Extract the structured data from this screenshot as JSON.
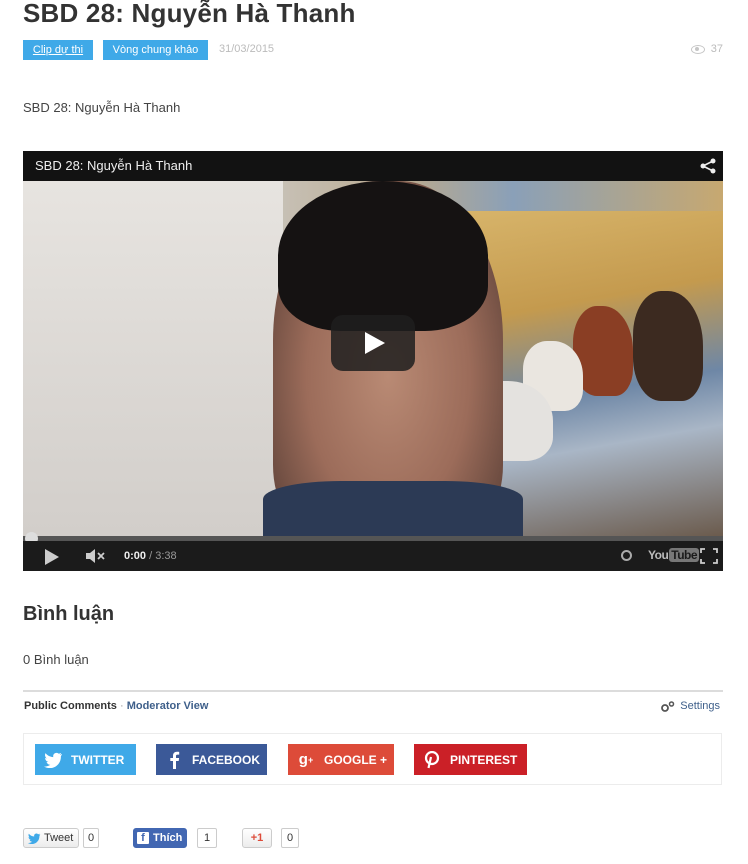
{
  "post": {
    "title": "SBD 28: Nguyễn Hà Thanh",
    "tags": [
      "Clip dự thi",
      "Vòng chung khảo"
    ],
    "date": "31/03/2015",
    "views": "37",
    "intro": "SBD 28: Nguyễn Hà Thanh"
  },
  "video": {
    "title": "SBD 28: Nguyễn Hà Thanh",
    "current_time": "0:00",
    "duration": "/ 3:38",
    "logo_you": "You",
    "logo_tube": "Tube",
    "progress": 0
  },
  "comments": {
    "heading": "Bình luận",
    "count_text": "0 Bình luận",
    "public_label": "Public Comments",
    "separator": "·",
    "moderator_label": "Moderator View",
    "settings_label": "Settings"
  },
  "share_buttons": {
    "twitter": "TWITTER",
    "facebook": "FACEBOOK",
    "google": "GOOGLE +",
    "pinterest": "PINTEREST"
  },
  "social_counts": {
    "tweet_label": "Tweet",
    "tweet_count": "0",
    "like_label": "Thích",
    "like_count": "1",
    "gplus_label": "+1",
    "gplus_count": "0"
  },
  "colors": {
    "tag_blue": "#3fa9e8",
    "twitter": "#3fa9e8",
    "facebook": "#3b5998",
    "google": "#dd4b39",
    "pinterest": "#cb2027"
  }
}
